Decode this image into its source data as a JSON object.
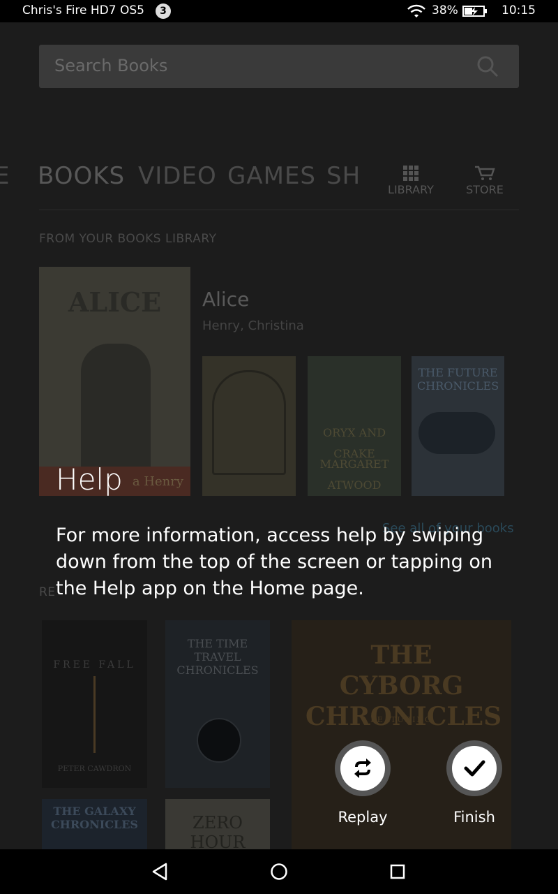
{
  "status_bar": {
    "device_name": "Chris's Fire HD7 OS5",
    "notification_count": "3",
    "battery_percent": "38%",
    "time": "10:15"
  },
  "app": {
    "search": {
      "placeholder": "Search Books"
    },
    "tabs": [
      "E",
      "BOOKS",
      "VIDEO",
      "GAMES",
      "SH"
    ],
    "top_nav": {
      "library": "LIBRARY",
      "store": "STORE"
    },
    "library_section": {
      "title": "FROM YOUR BOOKS LIBRARY",
      "featured": {
        "title": "Alice",
        "author": "Henry, Christina",
        "cover_title": "ALICE",
        "cover_author": "a Henry"
      },
      "covers": [
        {
          "line1": "",
          "line2": ""
        },
        {
          "line1": "ORYX AND CRAKE",
          "line2": "MARGARET ATWOOD"
        },
        {
          "line1": "THE FUTURE CHRONICLES",
          "line2": ""
        }
      ],
      "see_all": "See all of your books"
    },
    "recommended_section": {
      "title": "RE",
      "covers": [
        {
          "line1": "FREE FALL",
          "line2": "PETER CAWDRON"
        },
        {
          "line1": "THE TIME TRAVEL CHRONICLES",
          "line2": ""
        },
        {
          "line1": "THE CYBORG CHRONICLES",
          "line2": "FEATURING"
        },
        {
          "line1": "THE GALAXY CHRONICLES",
          "line2": ""
        },
        {
          "line1": "ZERO HOUR",
          "line2": ""
        }
      ]
    }
  },
  "overlay": {
    "title": "Help",
    "body": "For more information, access help by swiping down from the top of the screen or tapping on the Help app on the Home page.",
    "replay_label": "Replay",
    "finish_label": "Finish"
  }
}
